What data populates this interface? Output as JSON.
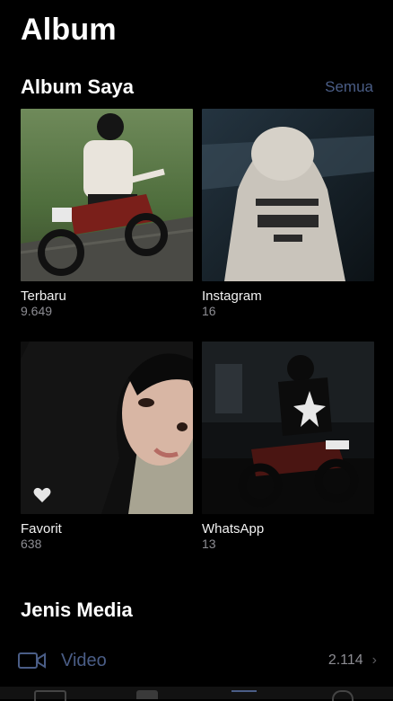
{
  "header": {
    "title": "Album"
  },
  "my_albums": {
    "title": "Album Saya",
    "see_all": "Semua",
    "albums": [
      {
        "name": "Terbaru",
        "count": "9.649"
      },
      {
        "name": "Instagram",
        "count": "16"
      },
      {
        "name": "Favorit",
        "count": "638"
      },
      {
        "name": "WhatsApp",
        "count": "13"
      }
    ]
  },
  "media_types": {
    "title": "Jenis Media",
    "items": [
      {
        "label": "Video",
        "count": "2.114",
        "icon": "video-icon"
      }
    ]
  },
  "tabbar": {
    "items": [
      "photos-tab-icon",
      "for-you-tab-icon",
      "albums-tab-icon",
      "search-tab-icon"
    ]
  },
  "colors": {
    "background": "#000000",
    "accent": "#4a5d86",
    "secondary_text": "#8d8d93"
  }
}
